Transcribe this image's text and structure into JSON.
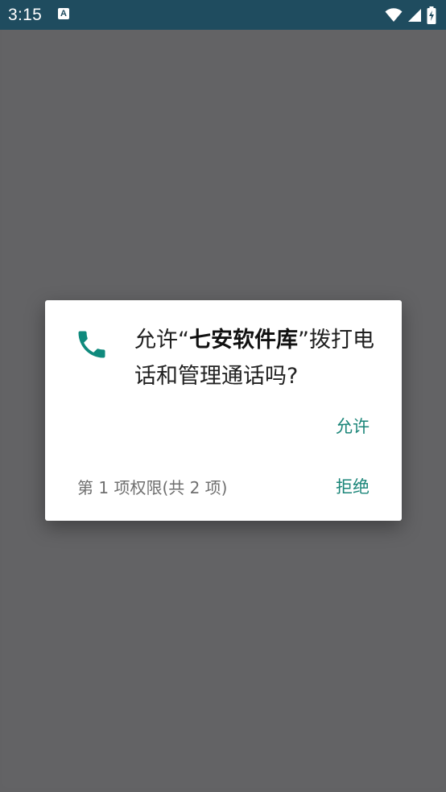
{
  "status_bar": {
    "time": "3:15",
    "notification_icon": "a-notification-icon",
    "wifi_icon": "wifi-icon",
    "signal_icon": "signal-icon",
    "battery_icon": "battery-charging-icon",
    "colors": {
      "background": "#1f4c5f",
      "foreground": "#ffffff"
    }
  },
  "dialog": {
    "icon": "phone-icon",
    "message_prefix": "允许“",
    "app_name": "七安软件库",
    "message_suffix": "”拨打电话和管理通话吗?",
    "allow_label": "允许",
    "counter_text": "第 1 项权限(共 2 项)",
    "deny_label": "拒绝",
    "colors": {
      "accent": "#1a8578",
      "icon": "#0f8a7d",
      "surface": "#ffffff"
    }
  }
}
